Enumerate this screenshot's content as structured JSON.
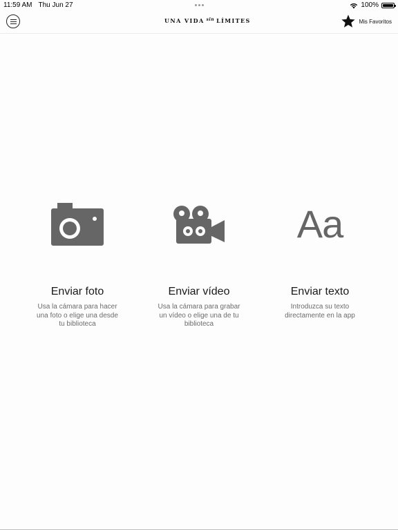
{
  "status_bar": {
    "time": "11:59 AM",
    "date": "Thu Jun 27",
    "battery": "100%",
    "icons": [
      "wifi-icon",
      "battery-icon"
    ]
  },
  "nav": {
    "menu_icon": "hamburger-menu-icon",
    "logo_part1": "UNA VIDA",
    "logo_part2": "sin",
    "logo_part3": "LÍMITES",
    "favorites_icon": "star-icon",
    "favorites_label": "Mis Favoritos"
  },
  "options": [
    {
      "icon": "camera-icon",
      "title": "Enviar foto",
      "description": "Usa la cámara para hacer una foto o elige una desde tu biblioteca"
    },
    {
      "icon": "video-camera-icon",
      "title": "Enviar vídeo",
      "description": "Usa la cámara para grabar un vídeo o elige una de tu biblioteca"
    },
    {
      "icon": "text-aa-icon",
      "icon_text": "Aa",
      "title": "Enviar texto",
      "description": "Introduzca su texto directamente en la app"
    }
  ],
  "colors": {
    "icon_gray": "#666666",
    "text_dark": "#1a1a1a",
    "text_muted": "#6b6b6b"
  }
}
